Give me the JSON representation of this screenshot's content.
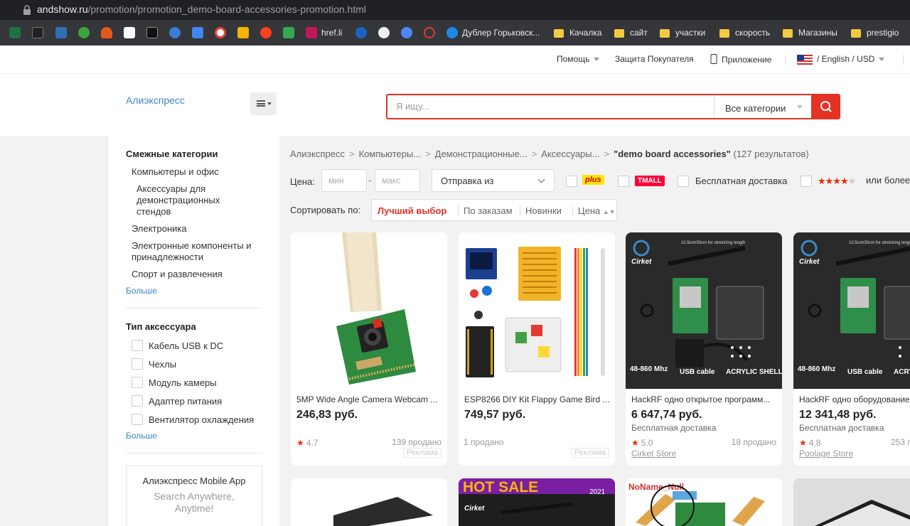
{
  "browser": {
    "url_host": "andshow.ru",
    "url_path": "/promotion/promotion_demo-board-accessories-promotion.html",
    "bookmarks": [
      "href.li",
      "Дублер Горьковск...",
      "Качалка",
      "сайт",
      "участки",
      "скорость",
      "Магазины",
      "prestigio"
    ]
  },
  "topbar": {
    "help": "Помощь",
    "protection": "Защита Покупателя",
    "app": "Приложение",
    "lang_currency": "/ English /  USD"
  },
  "header": {
    "logo": "Алиэкспресс",
    "search_placeholder": "Я ищу...",
    "category": "Все категории"
  },
  "sidebar": {
    "related_title": "Смежные категории",
    "related": [
      "Компьютеры и офис",
      "Аксессуары для демонстрационных стендов",
      "Электроника",
      "Электронные компоненты и принадлежности",
      "Спорт и развлечения"
    ],
    "more1": "Больше",
    "type_title": "Тип аксессуара",
    "types": [
      "Кабель USB к DC",
      "Чехлы",
      "Модуль камеры",
      "Адаптер питания",
      "Вентилятор охлаждения"
    ],
    "more2": "Больше",
    "app_title": "Алиэкспресс Mobile App",
    "app_sub1": "Search Anywhere,",
    "app_sub2": "Anytime!"
  },
  "breadcrumb": {
    "items": [
      "Алиэкспресс",
      "Компьютеры...",
      "Демонстрационные...",
      "Аксессуары..."
    ],
    "query": "\"demo board accessories\"",
    "count": "(127 результатов)"
  },
  "filters": {
    "price_label": "Цена:",
    "min_placeholder": "мин",
    "max_placeholder": "макс",
    "ship_from": "Отправка из",
    "plus": "plus",
    "tmall": "TMALL",
    "free_ship": "Бесплатная доставка",
    "rating_more": "или более"
  },
  "sort": {
    "label": "Сортировать по:",
    "options": [
      "Лучший выбор",
      "По заказам",
      "Новинки",
      "Цена"
    ]
  },
  "products": [
    {
      "title": "5MP Wide Angle Camera Webcam ...",
      "price": "246,83 руб.",
      "shipping": "",
      "rating": "4.7",
      "sold": "139 продано",
      "store": "",
      "ad": "Реклама"
    },
    {
      "title": "ESP8266 DIY Kit Flappy Game Bird ...",
      "price": "749,57 руб.",
      "shipping": "",
      "rating": "",
      "sold": "1 продано",
      "store": "",
      "ad": "Реклама"
    },
    {
      "title": "HackRF одно открытое программ...",
      "price": "6 647,74 руб.",
      "shipping": "Бесплатная доставка",
      "rating": "5.0",
      "sold": "18 продано",
      "store": "Cirket Store",
      "ad": ""
    },
    {
      "title": "HackRF одно оборудование ...",
      "price": "12 341,48 руб.",
      "shipping": "Бесплатная доставка",
      "rating": "4.8",
      "sold": "253 п",
      "store": "Poolage Store",
      "ad": ""
    }
  ],
  "image_text": {
    "cirket": "Cirket",
    "freq": "48-860 Mhz",
    "usb": "USB cable",
    "shell": "ACRYLIC SHELL",
    "length": "10.5cm/30cm for stretching length",
    "hot_sale": "HOT SALE",
    "year": "2021",
    "noname": "NoName_Null"
  },
  "colors": {
    "accent": "#e43225",
    "link": "#3d88c7",
    "star": "#e62e04"
  }
}
